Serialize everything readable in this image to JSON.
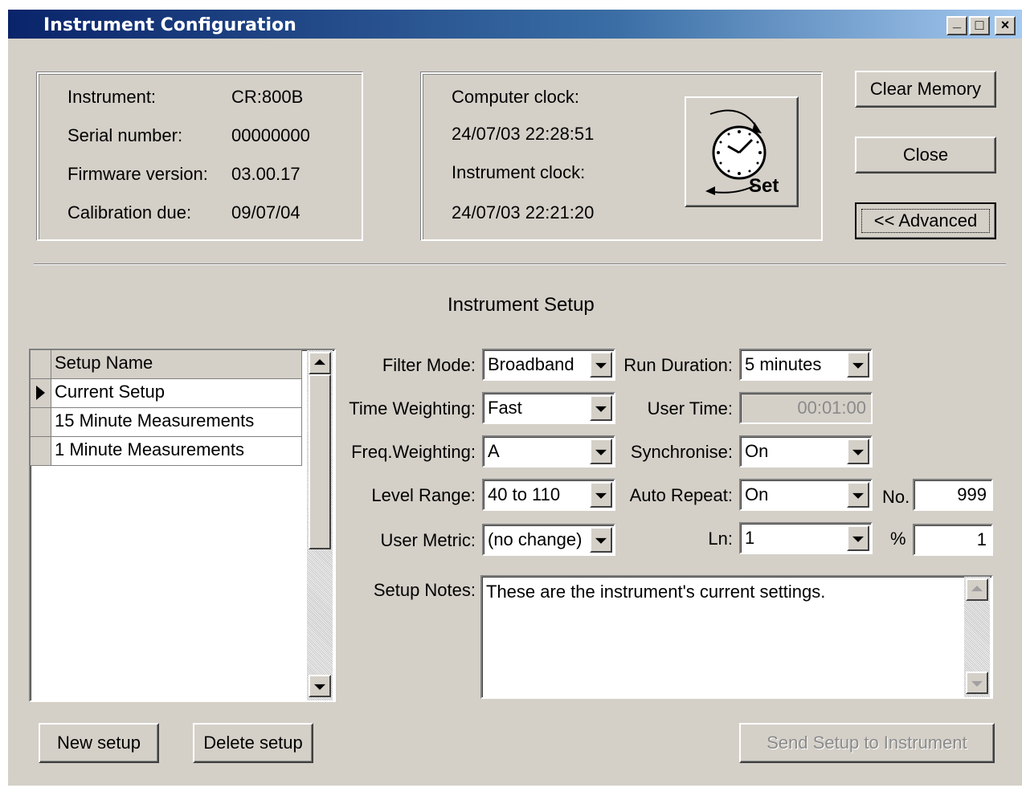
{
  "window": {
    "title": "Instrument Configuration",
    "controls": [
      "_",
      "□",
      "×"
    ]
  },
  "instrument_info": {
    "rows": [
      {
        "label": "Instrument:",
        "value": "CR:800B"
      },
      {
        "label": "Serial number:",
        "value": "00000000"
      },
      {
        "label": "Firmware version:",
        "value": "03.00.17"
      },
      {
        "label": "Calibration due:",
        "value": "09/07/04"
      }
    ]
  },
  "clock": {
    "computer_label": "Computer clock:",
    "computer_value": "24/07/03 22:28:51",
    "instrument_label": "Instrument clock:",
    "instrument_value": "24/07/03 22:21:20",
    "set_label": "Set"
  },
  "actions": {
    "clear_memory": "Clear Memory",
    "close": "Close",
    "advanced": "<< Advanced"
  },
  "setup": {
    "heading": "Instrument Setup",
    "list_header": "Setup Name",
    "list_items": [
      "Current Setup",
      "15 Minute Measurements",
      "1 Minute Measurements"
    ],
    "new_button": "New setup",
    "delete_button": "Delete setup",
    "send_button": "Send Setup to Instrument"
  },
  "fields": {
    "filter_mode": {
      "label": "Filter Mode:",
      "value": "Broadband"
    },
    "time_weighting": {
      "label": "Time Weighting:",
      "value": "Fast"
    },
    "freq_weighting": {
      "label": "Freq.Weighting:",
      "value": "A"
    },
    "level_range": {
      "label": "Level Range:",
      "value": "40 to 110"
    },
    "user_metric": {
      "label": "User Metric:",
      "value": "(no change)"
    },
    "run_duration": {
      "label": "Run Duration:",
      "value": "5 minutes"
    },
    "user_time": {
      "label": "User Time:",
      "value": "00:01:00"
    },
    "synchronise": {
      "label": "Synchronise:",
      "value": "On"
    },
    "auto_repeat": {
      "label": "Auto Repeat:",
      "value": "On"
    },
    "ln": {
      "label": "Ln:",
      "value": "1"
    },
    "no": {
      "label": "No.",
      "value": "999"
    },
    "percent": {
      "label": "%",
      "value": "1"
    },
    "setup_notes": {
      "label": "Setup Notes:",
      "value": "These are the instrument's current settings."
    }
  }
}
